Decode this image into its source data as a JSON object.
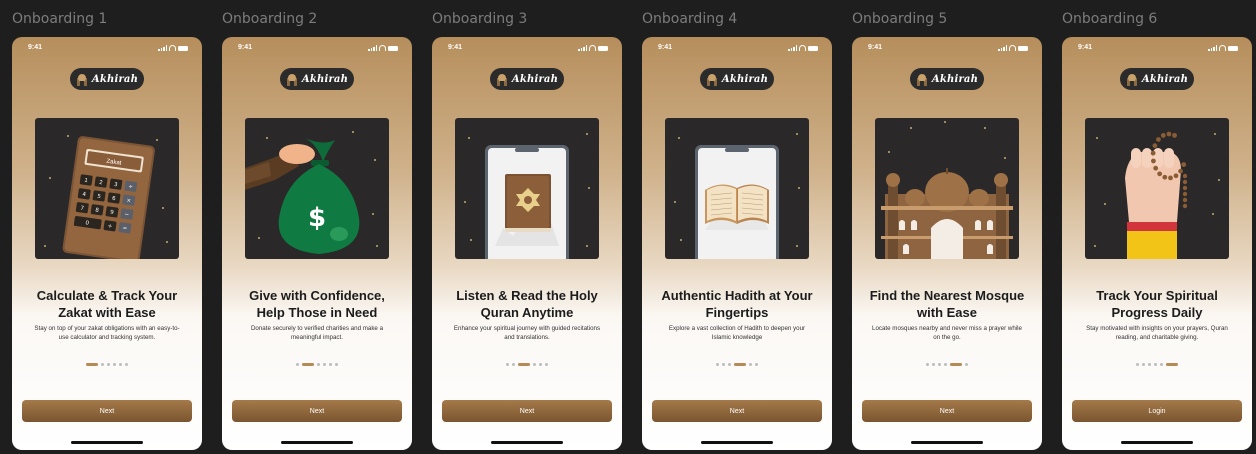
{
  "frames": [
    {
      "frame_label": "Onboarding 1",
      "time": "9:41",
      "logo": "Akhirah",
      "title_line1": "Calculate & Track Your",
      "title_line2": "Zakat with Ease",
      "desc_line1": "Stay on top of your zakat obligations with an easy-to-",
      "desc_line2": "use calculator and tracking system.",
      "active_dot": 0,
      "button": "Next",
      "illustration": "calculator-icon",
      "illus_text": "Zakat",
      "calc_keys": [
        "1",
        "2",
        "3",
        "÷",
        "4",
        "5",
        "6",
        "×",
        "7",
        "8",
        "9",
        "−",
        "0",
        "",
        "+",
        "="
      ]
    },
    {
      "frame_label": "Onboarding 2",
      "time": "9:41",
      "logo": "Akhirah",
      "title_line1": "Give with Confidence,",
      "title_line2": "Help Those in Need",
      "desc_line1": "Donate securely to verified charities and make a",
      "desc_line2": "meaningful impact.",
      "active_dot": 1,
      "button": "Next",
      "illustration": "money-bag-icon",
      "illus_text": "$"
    },
    {
      "frame_label": "Onboarding 3",
      "time": "9:41",
      "logo": "Akhirah",
      "title_line1": "Listen & Read the Holy",
      "title_line2": "Quran Anytime",
      "desc_line1": "Enhance your spiritual journey with guided recitations",
      "desc_line2": "and translations.",
      "active_dot": 2,
      "button": "Next",
      "illustration": "quran-book-icon"
    },
    {
      "frame_label": "Onboarding 4",
      "time": "9:41",
      "logo": "Akhirah",
      "title_line1": "Authentic Hadith at Your",
      "title_line2": "Fingertips",
      "desc_line1": "Explore a vast collection of Hadith to deepen your",
      "desc_line2": "Islamic knowledge",
      "active_dot": 3,
      "button": "Next",
      "illustration": "open-book-icon"
    },
    {
      "frame_label": "Onboarding 5",
      "time": "9:41",
      "logo": "Akhirah",
      "title_line1": "Find the Nearest Mosque",
      "title_line2": "with Ease",
      "desc_line1": "Locate mosques nearby and never miss a prayer while",
      "desc_line2": "on the go.",
      "active_dot": 4,
      "button": "Next",
      "illustration": "mosque-icon"
    },
    {
      "frame_label": "Onboarding 6",
      "time": "9:41",
      "logo": "Akhirah",
      "title_line1": "Track Your Spiritual",
      "title_line2": "Progress Daily",
      "desc_line1": "Stay motivated with insights on your prayers, Quran",
      "desc_line2": "reading, and charitable giving.",
      "active_dot": 5,
      "button": "Login",
      "illustration": "prayer-beads-hand-icon"
    }
  ],
  "dot_count": 6,
  "colors": {
    "background": "#1e1e1e",
    "accent": "#b58a55",
    "button_top": "#a57a4a",
    "button_bottom": "#7a5530",
    "illustration_bg": "#2a2828"
  }
}
